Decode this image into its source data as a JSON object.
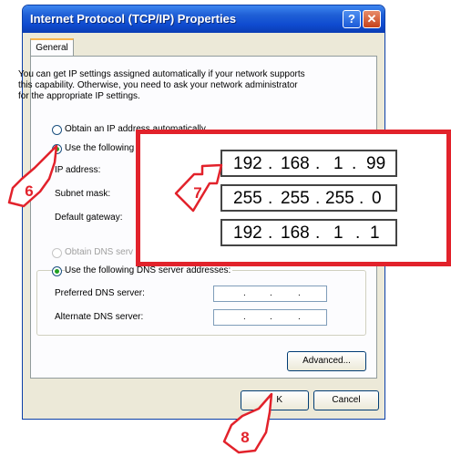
{
  "window": {
    "title": "Internet Protocol (TCP/IP) Properties",
    "help_label": "?",
    "close_label": "✕"
  },
  "tabs": [
    {
      "label": "General"
    }
  ],
  "description": [
    "You can get IP settings assigned automatically if your network supports",
    "this capability. Otherwise, you need to ask your network administrator",
    "for the appropriate IP settings."
  ],
  "ip_section": {
    "auto_label": "Obtain an IP address automatically",
    "manual_label": "Use the following",
    "fields": [
      {
        "label": "IP address:"
      },
      {
        "label": "Subnet mask:"
      },
      {
        "label": "Default gateway:"
      }
    ]
  },
  "dns_section": {
    "auto_label": "Obtain DNS serv",
    "manual_label": "Use the following DNS server addresses:",
    "fields": [
      {
        "label": "Preferred DNS server:",
        "octets": [
          "",
          "",
          "",
          ""
        ],
        "dot": "."
      },
      {
        "label": "Alternate DNS server:",
        "octets": [
          "",
          "",
          "",
          ""
        ],
        "dot": "."
      }
    ]
  },
  "zoom": {
    "dot": ".",
    "rows": [
      {
        "octets": [
          "192",
          "168",
          "1",
          "99"
        ]
      },
      {
        "octets": [
          "255",
          "255",
          "255",
          "0"
        ]
      },
      {
        "octets": [
          "192",
          "168",
          "1",
          "1"
        ]
      }
    ]
  },
  "buttons": {
    "advanced": "Advanced...",
    "ok": "OK",
    "ok_visible": "K",
    "cancel": "Cancel"
  },
  "steps": [
    "6",
    "7",
    "8"
  ],
  "colors": {
    "callout_red": "#e2222b",
    "titlebar_blue": "#0f4bd0"
  }
}
